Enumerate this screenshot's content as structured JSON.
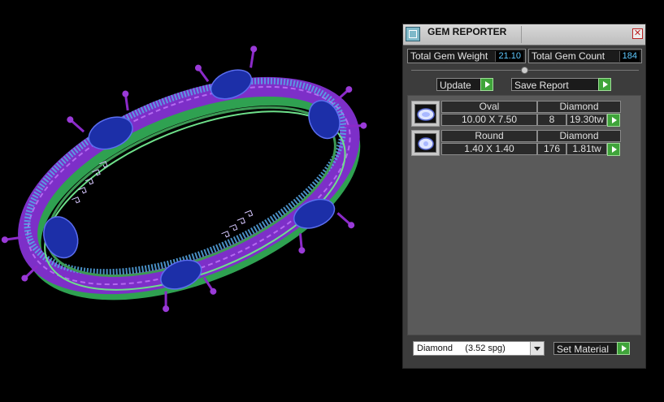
{
  "window": {
    "title": "GEM REPORTER",
    "close_glyph": "✕"
  },
  "stats": {
    "total_weight_label": "Total Gem Weight",
    "total_weight_value": "21.10",
    "total_count_label": "Total Gem Count",
    "total_count_value": "184"
  },
  "buttons": {
    "update_label": "Update",
    "save_report_label": "Save Report",
    "set_material_label": "Set Material"
  },
  "gems": [
    {
      "shape": "Oval",
      "material": "Diamond",
      "size": "10.00 X 7.50",
      "count": "8",
      "weight": "19.30tw",
      "icon": "oval-gem-icon"
    },
    {
      "shape": "Round",
      "material": "Diamond",
      "size": "1.40 X 1.40",
      "count": "176",
      "weight": "1.81tw",
      "icon": "round-gem-icon"
    }
  ],
  "material_select": {
    "value": "Diamond     (3.52 spg)"
  },
  "colors": {
    "accent_green": "#3fa43a",
    "value_blue": "#5ec9ff",
    "ring_purple": "#8a2fd0",
    "ring_green": "#4fd16a",
    "gem_blue": "#2233aa"
  }
}
